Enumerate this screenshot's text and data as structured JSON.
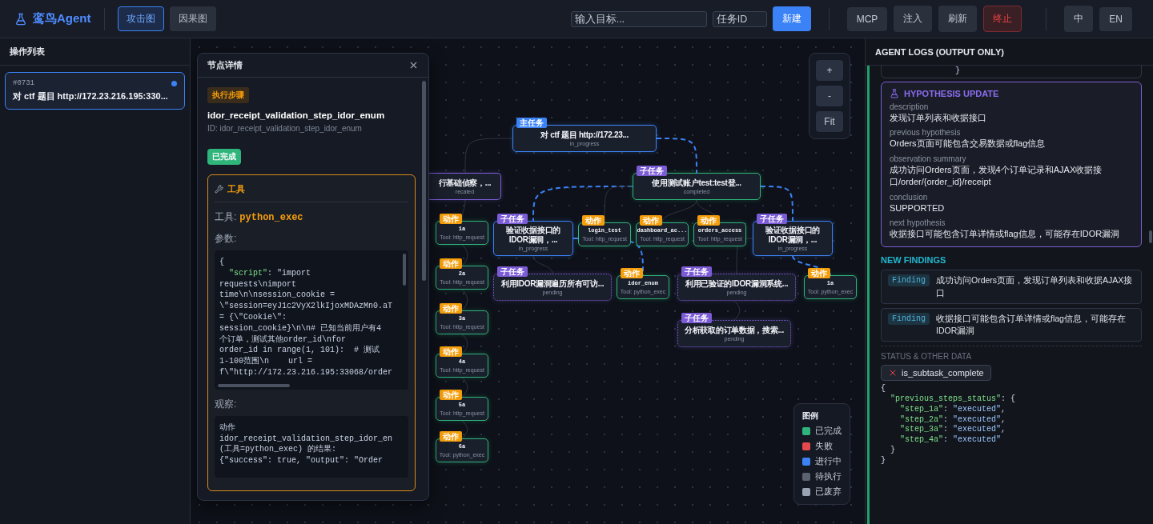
{
  "app": {
    "title": "鸾鸟Agent"
  },
  "view_tabs": [
    {
      "label": "攻击图",
      "selected": true
    },
    {
      "label": "因果图",
      "selected": false
    }
  ],
  "target_field": {
    "placeholder": "输入目标..."
  },
  "task_id_field": {
    "placeholder": "任务ID"
  },
  "create_button": "新建",
  "toolbar_buttons": [
    {
      "label": "MCP",
      "kind": "normal"
    },
    {
      "label": "注入",
      "kind": "normal"
    },
    {
      "label": "刷新",
      "kind": "normal"
    },
    {
      "label": "终止",
      "kind": "danger"
    }
  ],
  "language_buttons": [
    "中",
    "EN"
  ],
  "sidebar": {
    "title": "操作列表",
    "items": [
      {
        "id_label": "#0731",
        "title": "对 ctf 题目 http://172.23.216.195:330...",
        "selected": true,
        "running": true
      }
    ]
  },
  "graph": {
    "root": {
      "kind": "main",
      "badge": "主任务",
      "title": "对 ctf 题目 http://172.23...",
      "status": "in_progress",
      "children": [
        {
          "kind": "subtask",
          "title": "行基础侦察，...",
          "status": "recated",
          "highlighted": false,
          "children": [
            {
              "kind": "action",
              "badge": "动作",
              "title": "1a",
              "tool": "Tool: http_request",
              "highlighted": false
            },
            {
              "kind": "action",
              "badge": "动作",
              "title": "2a",
              "tool": "Tool: http_request",
              "highlighted": false
            },
            {
              "kind": "action",
              "badge": "动作",
              "title": "3a",
              "tool": "Tool: http_request",
              "highlighted": false
            },
            {
              "kind": "action",
              "badge": "动作",
              "title": "4a",
              "tool": "Tool: http_request",
              "highlighted": false
            },
            {
              "kind": "action",
              "badge": "动作",
              "title": "5a",
              "tool": "Tool: http_request",
              "highlighted": false
            },
            {
              "kind": "action",
              "badge": "动作",
              "title": "6a",
              "tool": "Tool: python_exec",
              "highlighted": false
            }
          ]
        },
        {
          "kind": "subtask",
          "badge": "子任务",
          "title": "使用测试账户test:test登...",
          "status": "completed",
          "highlighted": true,
          "children": [
            {
              "kind": "subtask",
              "badge": "子任务",
              "title": "验证收据接口的IDOR漏洞，...",
              "status": "in_progress",
              "highlighted": true,
              "children": [
                {
                  "kind": "subtask",
                  "badge": "子任务",
                  "title": "利用IDOR漏洞遍历所有可访...",
                  "status": "pending",
                  "highlighted": false
                },
                {
                  "kind": "action",
                  "badge": "动作",
                  "title": "idor_enum",
                  "tool": "Tool: python_exec",
                  "highlighted": true
                }
              ]
            },
            {
              "kind": "action",
              "badge": "动作",
              "title": "login_test",
              "tool": "Tool: http_request",
              "highlighted": false
            },
            {
              "kind": "action",
              "badge": "动作",
              "title": "dashboard_ac...",
              "tool": "Tool: http_request",
              "highlighted": false
            },
            {
              "kind": "action",
              "badge": "动作",
              "title": "orders_access",
              "tool": "Tool: http_request",
              "highlighted": false
            },
            {
              "kind": "subtask",
              "badge": "子任务",
              "title": "验证收据接口的IDOR漏洞，...",
              "status": "in_progress",
              "highlighted": true,
              "children": [
                {
                  "kind": "subtask",
                  "badge": "子任务",
                  "title": "利用已验证的IDOR漏洞系统...",
                  "status": "pending",
                  "highlighted": false,
                  "children": [
                    {
                      "kind": "subtask",
                      "badge": "子任务",
                      "title": "分析获取的订单数据，搜索...",
                      "status": "pending",
                      "highlighted": false
                    }
                  ]
                },
                {
                  "kind": "action",
                  "badge": "动作",
                  "title": "1a",
                  "tool": "Tool: python_exec",
                  "highlighted": true
                }
              ]
            }
          ]
        }
      ]
    },
    "zoom_controls": [
      "+",
      "-",
      "Fit"
    ],
    "legend": {
      "title": "图例",
      "items": [
        {
          "label": "已完成",
          "color": "#2fb47c"
        },
        {
          "label": "失败",
          "color": "#e5484d"
        },
        {
          "label": "进行中",
          "color": "#3b82f6"
        },
        {
          "label": "待执行",
          "color": "#5b6270"
        },
        {
          "label": "已废弃",
          "color": "#9aa3b2"
        }
      ]
    }
  },
  "details": {
    "title": "节点详情",
    "type_badge": "执行步骤",
    "name": "idor_receipt_validation_step_idor_enum",
    "id_line": "ID: idor_receipt_validation_step_idor_enum",
    "status": {
      "label": "已完成"
    },
    "tool_card": {
      "heading": "工具",
      "tool_label": "工具:",
      "tool_name": "python_exec",
      "params_label": "参数:",
      "params_lines": [
        "{",
        [
          {
            "text": "  \"script\"",
            "kind": "key"
          },
          {
            "text": ": \"import",
            "kind": "plain"
          }
        ],
        "requests\\nimport",
        "time\\n\\nsession_cookie =",
        "\\\"session=eyJ1c2VyX2lkIjoxMDAzMn0.aT",
        "= {\\\"Cookie\\\":",
        "session_cookie}\\n\\n# 已知当前用户有4",
        "个订单，测试其他order_id\\nfor",
        "order_id in range(1, 101):  # 测试",
        "1-100范围\\n    url =",
        "f\\\"http://172.23.216.195:33068/order"
      ],
      "observation_label": "观察:",
      "observation_lines": [
        "动作",
        "idor_receipt_validation_step_idor_en",
        "(工具=python_exec) 的结果:",
        "{\"success\": true, \"output\": \"Order"
      ]
    }
  },
  "logs": {
    "title": "AGENT LOGS (OUTPUT ONLY)",
    "previous_tail": "}",
    "hypothesis": {
      "heading": "HYPOTHESIS UPDATE",
      "fields": [
        {
          "label": "description",
          "value": "发现订单列表和收据接口"
        },
        {
          "label": "previous hypothesis",
          "value": "Orders页面可能包含交易数据或flag信息"
        },
        {
          "label": "observation summary",
          "value": "成功访问Orders页面，发现4个订单记录和AJAX收据接口/order/{order_id}/receipt"
        },
        {
          "label": "conclusion",
          "value": "SUPPORTED"
        },
        {
          "label": "next hypothesis",
          "value": "收据接口可能包含订单详情或flag信息，可能存在IDOR漏洞"
        }
      ]
    },
    "findings_heading": "NEW FINDINGS",
    "findings": [
      {
        "tag": "Finding",
        "text": "成功访问Orders页面，发现订单列表和收据AJAX接口"
      },
      {
        "tag": "Finding",
        "text": "收据接口可能包含订单详情或flag信息，可能存在IDOR漏洞"
      }
    ],
    "status_heading": "STATUS & OTHER DATA",
    "flags": [
      {
        "label": "is_subtask_complete",
        "checked": false
      }
    ],
    "data_lines": [
      "{",
      [
        {
          "text": "  \"previous_steps_status\"",
          "kind": "key"
        },
        {
          "text": ": {",
          "kind": "plain"
        }
      ],
      [
        {
          "text": "    \"step_1a\"",
          "kind": "key"
        },
        {
          "text": ": ",
          "kind": "plain"
        },
        {
          "text": "\"executed\"",
          "kind": "string"
        },
        {
          "text": ",",
          "kind": "plain"
        }
      ],
      [
        {
          "text": "    \"step_2a\"",
          "kind": "key"
        },
        {
          "text": ": ",
          "kind": "plain"
        },
        {
          "text": "\"executed\"",
          "kind": "string"
        },
        {
          "text": ",",
          "kind": "plain"
        }
      ],
      [
        {
          "text": "    \"step_3a\"",
          "kind": "key"
        },
        {
          "text": ": ",
          "kind": "plain"
        },
        {
          "text": "\"executed\"",
          "kind": "string"
        },
        {
          "text": ",",
          "kind": "plain"
        }
      ],
      [
        {
          "text": "    \"step_4a\"",
          "kind": "key"
        },
        {
          "text": ": ",
          "kind": "plain"
        },
        {
          "text": "\"executed\"",
          "kind": "string"
        }
      ],
      "  }",
      "}"
    ]
  }
}
